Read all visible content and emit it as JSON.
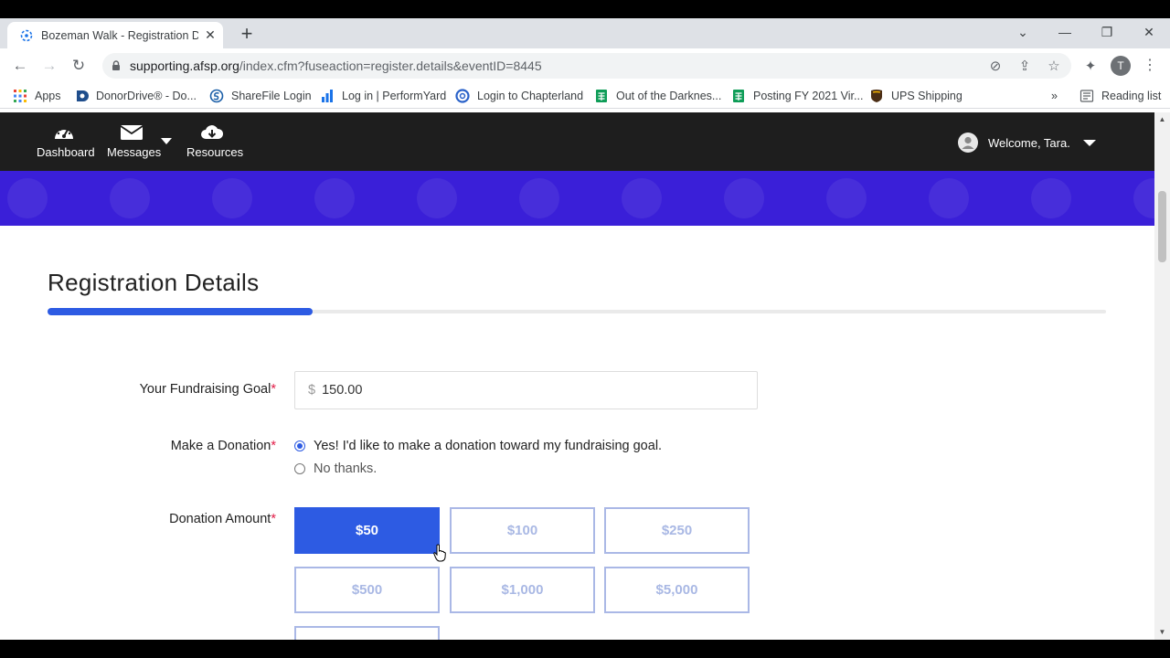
{
  "browser": {
    "tab_title": "Bozeman Walk - Registration Details",
    "url_host": "supporting.afsp.org",
    "url_path": "/index.cfm?fuseaction=register.details&eventID=8445",
    "profile_initial": "T",
    "bookmarks": [
      {
        "label": "Apps",
        "icon": "apps-grid-icon"
      },
      {
        "label": "DonorDrive® - Do...",
        "icon": "donordrive-icon"
      },
      {
        "label": "ShareFile Login",
        "icon": "sharefile-icon"
      },
      {
        "label": "Log in | PerformYard",
        "icon": "performyard-icon"
      },
      {
        "label": "Login to Chapterland",
        "icon": "chapterland-icon"
      },
      {
        "label": "Out of the Darknes...",
        "icon": "sheets-icon"
      },
      {
        "label": "Posting FY 2021 Vir...",
        "icon": "sheets-icon"
      },
      {
        "label": "UPS Shipping",
        "icon": "ups-icon"
      }
    ],
    "overflow_label": "»",
    "reading_list": "Reading list"
  },
  "site_nav": {
    "items": [
      {
        "label": "Dashboard",
        "icon": "dashboard-gauge-icon"
      },
      {
        "label": "Messages",
        "icon": "envelope-icon"
      },
      {
        "label": "Resources",
        "icon": "cloud-download-icon"
      }
    ],
    "welcome": "Welcome, Tara."
  },
  "page": {
    "title": "Registration Details",
    "progress_fraction": 0.25,
    "fields": {
      "goal_label": "Your Fundraising Goal",
      "currency": "$",
      "goal_value": "150.00",
      "donation_label": "Make a Donation",
      "donation_yes": "Yes! I'd like to make a donation toward my fundraising goal.",
      "donation_no": "No thanks.",
      "amount_label": "Donation Amount",
      "required_mark": "*"
    },
    "amounts": [
      "$50",
      "$100",
      "$250",
      "$500",
      "$1,000",
      "$5,000"
    ],
    "selected_amount": "$50"
  },
  "colors": {
    "accent": "#2d5be3",
    "banner": "#3a1fd8",
    "nav_bg": "#1e1e1e",
    "required": "#e11d48"
  }
}
